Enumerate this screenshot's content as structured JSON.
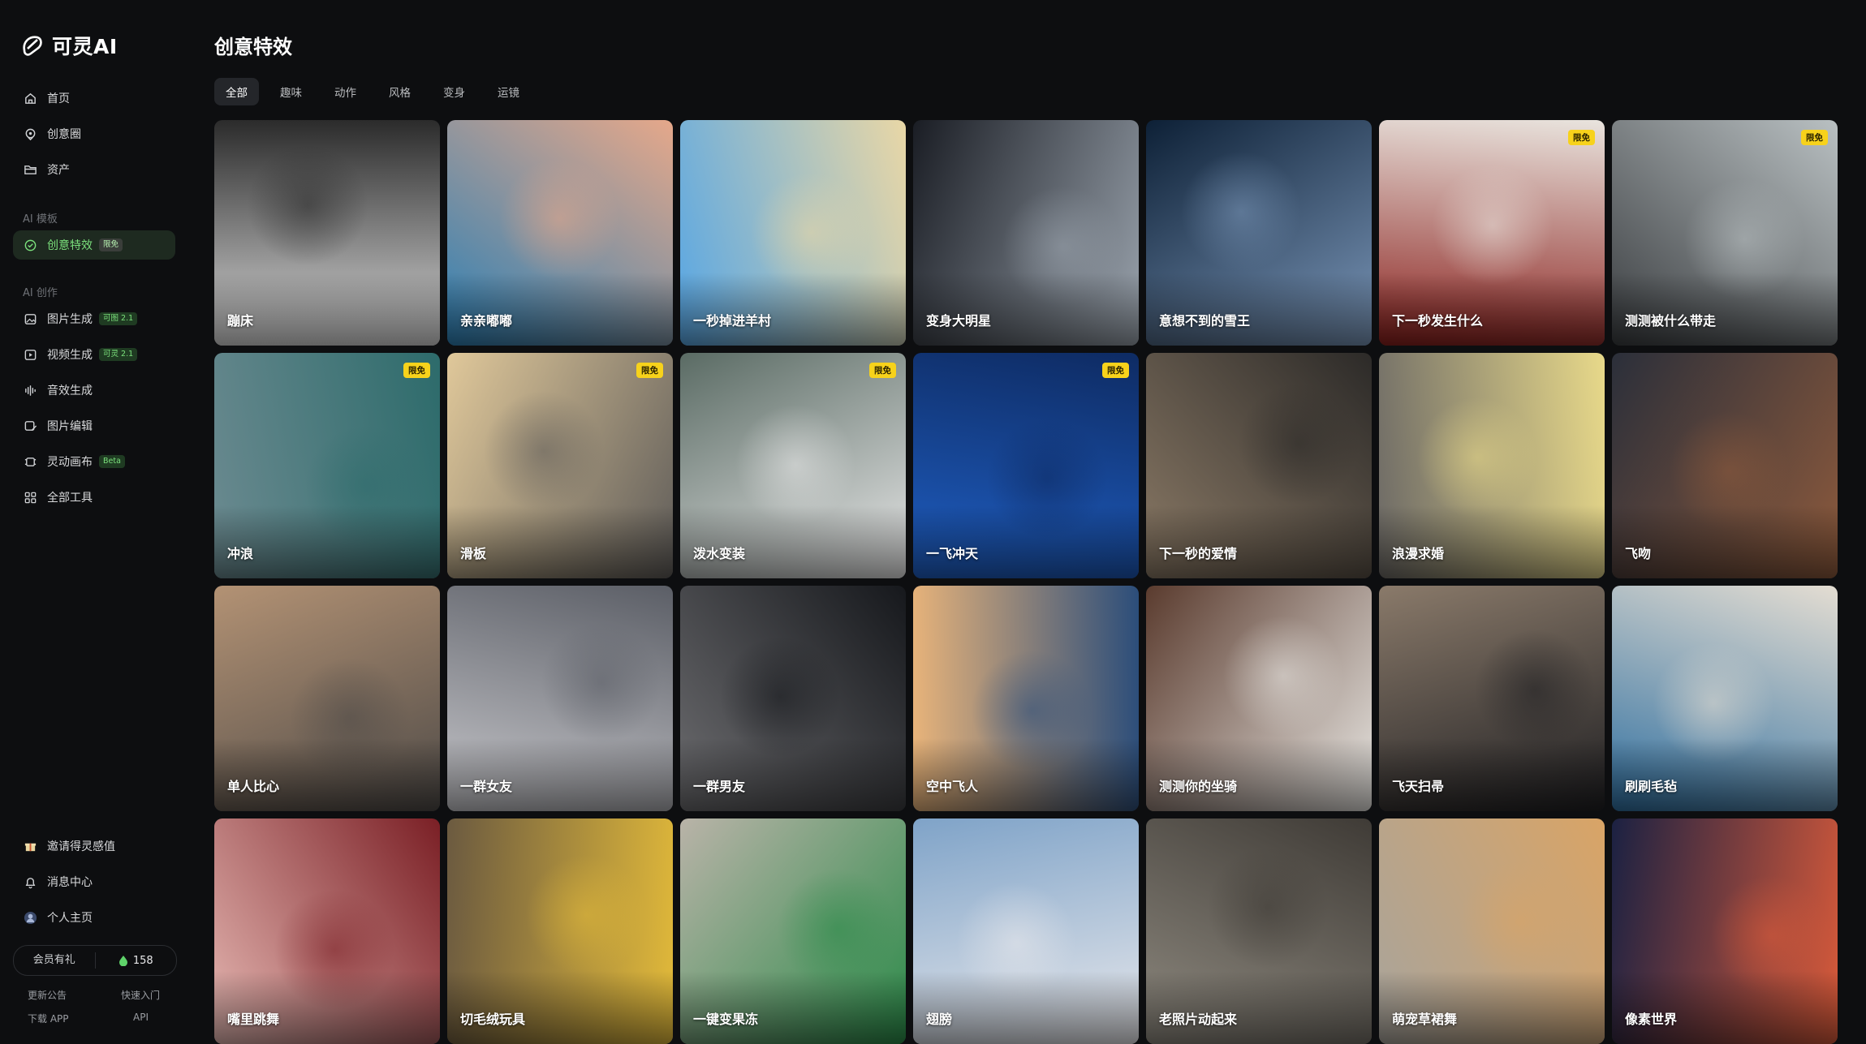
{
  "app": {
    "logo_text": "可灵AI"
  },
  "sidebar": {
    "top_items": [
      {
        "label": "首页",
        "icon": "home-icon"
      },
      {
        "label": "创意圈",
        "icon": "location-icon"
      },
      {
        "label": "资产",
        "icon": "folder-icon"
      }
    ],
    "section_templates": "AI 模板",
    "template_item": {
      "label": "创意特效",
      "tag": "限免",
      "icon": "effects-icon"
    },
    "section_create": "AI 创作",
    "create_items": [
      {
        "label": "图片生成",
        "tag": "可图 2.1",
        "icon": "image-icon"
      },
      {
        "label": "视频生成",
        "tag": "可灵 2.1",
        "icon": "video-icon"
      },
      {
        "label": "音效生成",
        "tag": "",
        "icon": "audio-wave-icon"
      },
      {
        "label": "图片编辑",
        "tag": "",
        "icon": "image-edit-icon"
      },
      {
        "label": "灵动画布",
        "tag": "Beta",
        "icon": "canvas-icon"
      },
      {
        "label": "全部工具",
        "tag": "",
        "icon": "grid-icon"
      }
    ],
    "bottom_items": [
      {
        "label": "邀请得灵感值",
        "icon": "gift-icon"
      },
      {
        "label": "消息中心",
        "icon": "bell-icon"
      },
      {
        "label": "个人主页",
        "icon": "avatar"
      }
    ],
    "member_label": "会员有礼",
    "points": "158",
    "footer": {
      "announcement": "更新公告",
      "quickstart": "快速入门",
      "download": "下载 APP",
      "api": "API"
    }
  },
  "main": {
    "title": "创意特效",
    "tabs": [
      "全部",
      "趣味",
      "动作",
      "风格",
      "变身",
      "运镜"
    ],
    "active_tab": 0,
    "cards": [
      {
        "title": "蹦床",
        "badge": "",
        "colors": [
          "#d9d9d9",
          "#2b2b2b"
        ]
      },
      {
        "title": "亲亲嘟嘟",
        "badge": "",
        "colors": [
          "#2c7fb4",
          "#e6a88a"
        ]
      },
      {
        "title": "一秒掉进羊村",
        "badge": "",
        "colors": [
          "#57a6e4",
          "#e9d7a6"
        ]
      },
      {
        "title": "变身大明星",
        "badge": "",
        "colors": [
          "#1a1d24",
          "#9aa3ad"
        ]
      },
      {
        "title": "意想不到的雪王",
        "badge": "",
        "colors": [
          "#0d2036",
          "#7a96b8"
        ]
      },
      {
        "title": "下一秒发生什么",
        "badge": "限免",
        "colors": [
          "#8a1f1c",
          "#e9e4de"
        ]
      },
      {
        "title": "测测被什么带走",
        "badge": "限免",
        "colors": [
          "#3a3d40",
          "#b9c0c2"
        ]
      },
      {
        "title": "冲浪",
        "badge": "限免",
        "colors": [
          "#6b8a90",
          "#2d6b6b"
        ]
      },
      {
        "title": "滑板",
        "badge": "限免",
        "colors": [
          "#e0c89a",
          "#5f5c59"
        ]
      },
      {
        "title": "泼水变装",
        "badge": "限免",
        "colors": [
          "#5a6b64",
          "#e8e8e8"
        ]
      },
      {
        "title": "一飞冲天",
        "badge": "限免",
        "colors": [
          "#1f5fc4",
          "#0e2b63"
        ]
      },
      {
        "title": "下一秒的爱情",
        "badge": "",
        "colors": [
          "#8b7a66",
          "#2c2a28"
        ]
      },
      {
        "title": "浪漫求婚",
        "badge": "",
        "colors": [
          "#6d6a66",
          "#e8d98a"
        ]
      },
      {
        "title": "飞吻",
        "badge": "",
        "colors": [
          "#2b2f3a",
          "#8d5a3c"
        ]
      },
      {
        "title": "单人比心",
        "badge": "",
        "colors": [
          "#b39274",
          "#4e4a47"
        ]
      },
      {
        "title": "一群女友",
        "badge": "",
        "colors": [
          "#c8c8cc",
          "#5b5e66"
        ]
      },
      {
        "title": "一群男友",
        "badge": "",
        "colors": [
          "#6d6d70",
          "#16181c"
        ]
      },
      {
        "title": "空中飞人",
        "badge": "",
        "colors": [
          "#e9b47a",
          "#2b4d7a"
        ]
      },
      {
        "title": "测测你的坐骑",
        "badge": "",
        "colors": [
          "#5a3b2e",
          "#e8e6e2"
        ]
      },
      {
        "title": "飞天扫帚",
        "badge": "",
        "colors": [
          "#8a7a6a",
          "#1f1f22"
        ]
      },
      {
        "title": "刷刷毛毡",
        "badge": "",
        "colors": [
          "#2f6fa0",
          "#e4ddd2"
        ]
      },
      {
        "title": "嘴里跳舞",
        "badge": "",
        "colors": [
          "#e5b7b2",
          "#7a1f25"
        ]
      },
      {
        "title": "切毛绒玩具",
        "badge": "",
        "colors": [
          "#6b5a40",
          "#e1b93a"
        ]
      },
      {
        "title": "一键变果冻",
        "badge": "",
        "colors": [
          "#b9b3a8",
          "#2a8a48"
        ]
      },
      {
        "title": "翅膀",
        "badge": "",
        "colors": [
          "#7fa3c8",
          "#e9e9ec"
        ]
      },
      {
        "title": "老照片动起来",
        "badge": "",
        "colors": [
          "#8f8a80",
          "#3f3b36"
        ]
      },
      {
        "title": "萌宠草裙舞",
        "badge": "",
        "colors": [
          "#a8a49c",
          "#d9a466"
        ]
      },
      {
        "title": "像素世界",
        "badge": "",
        "colors": [
          "#1b2142",
          "#d85a3a"
        ]
      }
    ]
  },
  "colors": {
    "accent": "#7be07c",
    "badge_bg": "#f7d21b",
    "bg": "#0d0e10"
  }
}
